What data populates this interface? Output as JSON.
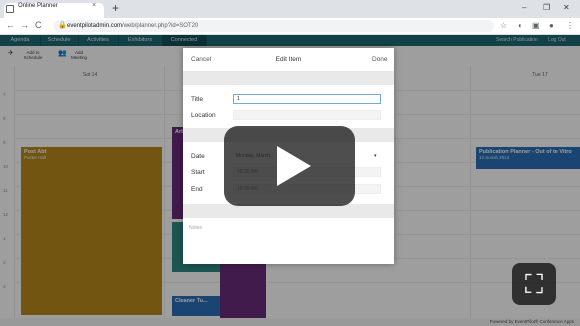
{
  "browser": {
    "tab_title": "Online Planner",
    "tab_close": "×",
    "new_tab": "+",
    "minimize": "–",
    "maximize": "❐",
    "close": "✕",
    "back": "←",
    "forward": "→",
    "reload": "C",
    "lock": "🔒",
    "url_host": "eventpilotadmin.com",
    "url_path": "/web/planner.php?id=SOT20"
  },
  "app_nav": {
    "tabs": [
      "Agenda",
      "Schedule",
      "Activities",
      "Exhibitors",
      "Connected"
    ],
    "active_index": 4,
    "right_items": [
      "Search Publication",
      "Log Out"
    ]
  },
  "toolbar": {
    "add_label": "Add to Schedule",
    "meeting_label": "Add Meeting"
  },
  "calendar": {
    "days": [
      "Sat 14",
      "Tue 17"
    ],
    "hours": [
      "7",
      "8",
      "9",
      "10",
      "11",
      "12",
      "1",
      "2",
      "3"
    ],
    "events": [
      {
        "title": "Post Abt",
        "sub": "Poster Hall",
        "color": "#b8891c"
      },
      {
        "title": "Arb",
        "sub": "",
        "color": "#6a2d7a"
      },
      {
        "title": "Publication Planner - Out of te Vitro",
        "sub": "12 Sunsh 2014",
        "color": "#2a6fb6"
      },
      {
        "title": "Cleaner Tu...",
        "sub": "",
        "color": "#2a6fb6"
      }
    ]
  },
  "modal": {
    "cancel": "Cancel",
    "title": "Edit Item",
    "done": "Done",
    "title_label": "Title",
    "title_value": "1",
    "location_label": "Location",
    "location_value": "",
    "date_label": "Date",
    "date_value": "Monday, March",
    "start_label": "Start",
    "start_value": "08:30 AM",
    "end_label": "End",
    "end_value": "10:00 AM",
    "notes_placeholder": "Notes"
  },
  "footer": {
    "text": "Powered by EventPilot® Conference Apps"
  },
  "player": {
    "play_icon": "play-icon",
    "fullscreen_icon": "fullscreen-icon",
    "fullscreen_glyph": "⛶"
  },
  "colors": {
    "nav_bg": "#1d6a74",
    "event_gold": "#b8891c",
    "event_purple": "#6a2d7a",
    "event_blue": "#2a6fb6",
    "event_teal": "#2f8a86"
  }
}
